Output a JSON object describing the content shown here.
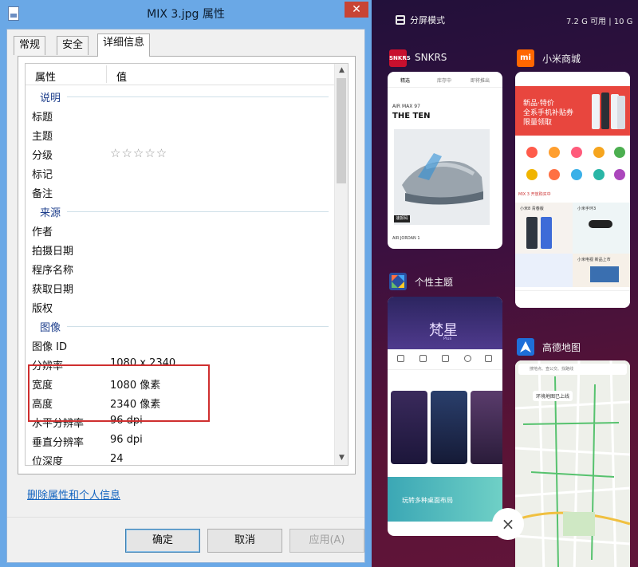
{
  "dialog": {
    "title": "MIX 3.jpg 属性",
    "tabs": [
      "常规",
      "安全",
      "详细信息"
    ],
    "active_tab": "详细信息",
    "columns": {
      "property": "属性",
      "value": "值"
    },
    "sections": {
      "description": "说明",
      "origin": "来源",
      "image": "图像"
    },
    "rows": {
      "title": "标题",
      "subject": "主题",
      "rating": "分级",
      "rating_value": "☆☆☆☆☆",
      "tags": "标记",
      "comments": "备注",
      "author": "作者",
      "date_taken": "拍摄日期",
      "program": "程序名称",
      "date_acquired": "获取日期",
      "copyright": "版权",
      "image_id": "图像 ID",
      "resolution": "分辨率",
      "resolution_value": "1080 x 2340",
      "width": "宽度",
      "width_value": "1080 像素",
      "height": "高度",
      "height_value": "2340 像素",
      "h_dpi": "水平分辨率",
      "h_dpi_value": "96 dpi",
      "v_dpi": "垂直分辨率",
      "v_dpi_value": "96 dpi",
      "bit_depth": "位深度",
      "bit_depth_value": "24"
    },
    "remove_link": "删除属性和个人信息",
    "buttons": {
      "ok": "确定",
      "cancel": "取消",
      "apply": "应用(A)"
    },
    "close_glyph": "✕"
  },
  "phone": {
    "split_mode": "分屏模式",
    "memory": "7.2 G 可用 | 10 G",
    "apps": {
      "snkrs": {
        "name": "SNKRS",
        "icon_text": "SNKRS",
        "tabs": [
          "精选",
          "库存中",
          "即将推出"
        ],
        "headline": "AIR MAX 97",
        "sub": "THE TEN",
        "btn": "速报码",
        "footer": "AIR JORDAN 1"
      },
      "mistore": {
        "name": "小米商城",
        "icon_text": "mi",
        "banner_l1": "新品·特价",
        "banner_l2": "全系手机补贴券",
        "banner_l3": "限量领取",
        "promo": "MIX 3 开放购买中",
        "g1": "小米8 青春版",
        "g2": "小米手环3",
        "g4": "小米电视 新品上市"
      },
      "theme": {
        "name": "个性主题",
        "title": "梵星",
        "subtitle": "Plus",
        "banner": "玩转多种桌面布局"
      },
      "maps": {
        "name": "高德地图",
        "search": "搜地点、查公交、找路线",
        "popup": "环境地图已上线"
      }
    },
    "close_glyph": "×",
    "colors": {
      "snkrs_icon": "#c8102e",
      "mi_icon": "#ff6700",
      "theme_icon": "#2a4fa0",
      "maps_icon": "#1e6fd9"
    }
  }
}
